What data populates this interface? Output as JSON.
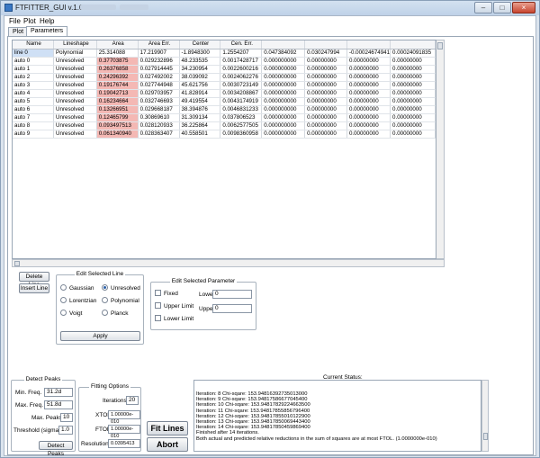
{
  "window": {
    "title": "FTFITTER_GUI v.1.0",
    "minimize": "–",
    "maximize": "□",
    "close": "×"
  },
  "menu": [
    "File",
    "Plot",
    "Help"
  ],
  "tabs": [
    "Plot",
    "Parameters"
  ],
  "table": {
    "headers": [
      "Name",
      "Lineshape",
      "Area",
      "Area Err.",
      "Center",
      "Cen. Err.",
      "",
      "",
      "",
      ""
    ],
    "rows": [
      [
        "line 0",
        "Polynomial",
        "25.314088",
        "17.219907",
        "-1.8948300",
        "1.2554207",
        "0.047384092",
        "0.030247994",
        "-0.00024674941",
        "0.00024091835"
      ],
      [
        "auto 0",
        "Unresolved",
        "0.37703875",
        "0.029232896",
        "48.233535",
        "0.0017428717",
        "0.000000000",
        "0.00000000",
        "0.00000000",
        "0.00000000"
      ],
      [
        "auto 1",
        "Unresolved",
        "0.26376858",
        "0.027914445",
        "34.230954",
        "0.0022600216",
        "0.000000000",
        "0.00000000",
        "0.00000000",
        "0.00000000"
      ],
      [
        "auto 2",
        "Unresolved",
        "0.24296392",
        "0.027492002",
        "38.039092",
        "0.0024062276",
        "0.000000000",
        "0.00000000",
        "0.00000000",
        "0.00000000"
      ],
      [
        "auto 3",
        "Unresolved",
        "0.19176744",
        "0.027744948",
        "45.621756",
        "0.0030723149",
        "0.000000000",
        "0.00000000",
        "0.00000000",
        "0.00000000"
      ],
      [
        "auto 4",
        "Unresolved",
        "0.19042713",
        "0.029703957",
        "41.828914",
        "0.0034208867",
        "0.000000000",
        "0.00000000",
        "0.00000000",
        "0.00000000"
      ],
      [
        "auto 5",
        "Unresolved",
        "0.16234664",
        "0.032746693",
        "49.419554",
        "0.0043174919",
        "0.000000000",
        "0.00000000",
        "0.00000000",
        "0.00000000"
      ],
      [
        "auto 6",
        "Unresolved",
        "0.13266951",
        "0.029668187",
        "38.394876",
        "0.0046831233",
        "0.000000000",
        "0.00000000",
        "0.00000000",
        "0.00000000"
      ],
      [
        "auto 7",
        "Unresolved",
        "0.12465799",
        "0.30869610",
        "31.309134",
        "0.037806523",
        "0.000000000",
        "0.00000000",
        "0.00000000",
        "0.00000000"
      ],
      [
        "auto 8",
        "Unresolved",
        "0.093497513",
        "0.028120933",
        "36.225864",
        "0.0062577505",
        "0.000000000",
        "0.00000000",
        "0.00000000",
        "0.00000000"
      ],
      [
        "auto 9",
        "Unresolved",
        "0.061340940",
        "0.028363407",
        "40.558501",
        "0.0098360958",
        "0.000000000",
        "0.00000000",
        "0.00000000",
        "0.00000000"
      ]
    ]
  },
  "line_buttons": {
    "delete": "Delete Line",
    "insert": "Insert Line"
  },
  "edit_line": {
    "title": "Edit Selected Line",
    "options": [
      "Gaussian",
      "Unresolved",
      "Lorentzian",
      "Polynomial",
      "Voigt",
      "Planck"
    ],
    "selected": "Unresolved",
    "apply": "Apply"
  },
  "edit_param": {
    "title": "Edit Selected Parameter",
    "fixed": "Fixed",
    "upper_limit": "Upper Limit",
    "lower_limit": "Lower Limit",
    "lower_label": "Lower",
    "lower_value": "0",
    "upper_label": "Upper",
    "upper_value": "0"
  },
  "detect": {
    "title": "Detect Peaks",
    "min_freq_label": "Min. Freq.",
    "min_freq": "31.2d",
    "max_freq_label": "Max. Freq.",
    "max_freq": "51.8d",
    "max_peaks_label": "Max. Peaks",
    "max_peaks": "10",
    "threshold_label": "Threshold (sigma)",
    "threshold": "1.0",
    "button": "Detect Peaks"
  },
  "fitting": {
    "title": "Fitting Options",
    "iterations_label": "Iterations",
    "iterations": "20",
    "xtol_label": "XTOL",
    "xtol": "1.00000e-010",
    "ftol_label": "FTOL",
    "ftol": "1.00000e-010",
    "resolution_label": "Resolution",
    "resolution": "0.0395413"
  },
  "actions": {
    "fit": "Fit Lines",
    "abort": "Abort"
  },
  "status": {
    "title": "Current Status:",
    "lines": [
      "Iteration: 8  Chi-sqare: 153.94816392735013000",
      "Iteration: 9  Chi-sqare: 153.94817586677045400",
      "Iteration: 10  Chi-sqare: 153.94817829224663500",
      "Iteration: 11  Chi-sqare: 153.94817855856796400",
      "Iteration: 12  Chi-sqare: 153.94817855010122900",
      "Iteration: 13  Chi-sqare: 153.94817850069443400",
      "Iteration: 14  Chi-sqare: 153.94817850459869400",
      "Finished after 14 iterations.",
      "Both actual and predicted relative reductions in the sum of squares are at most FTOL. (1.0000000e-010)"
    ]
  }
}
